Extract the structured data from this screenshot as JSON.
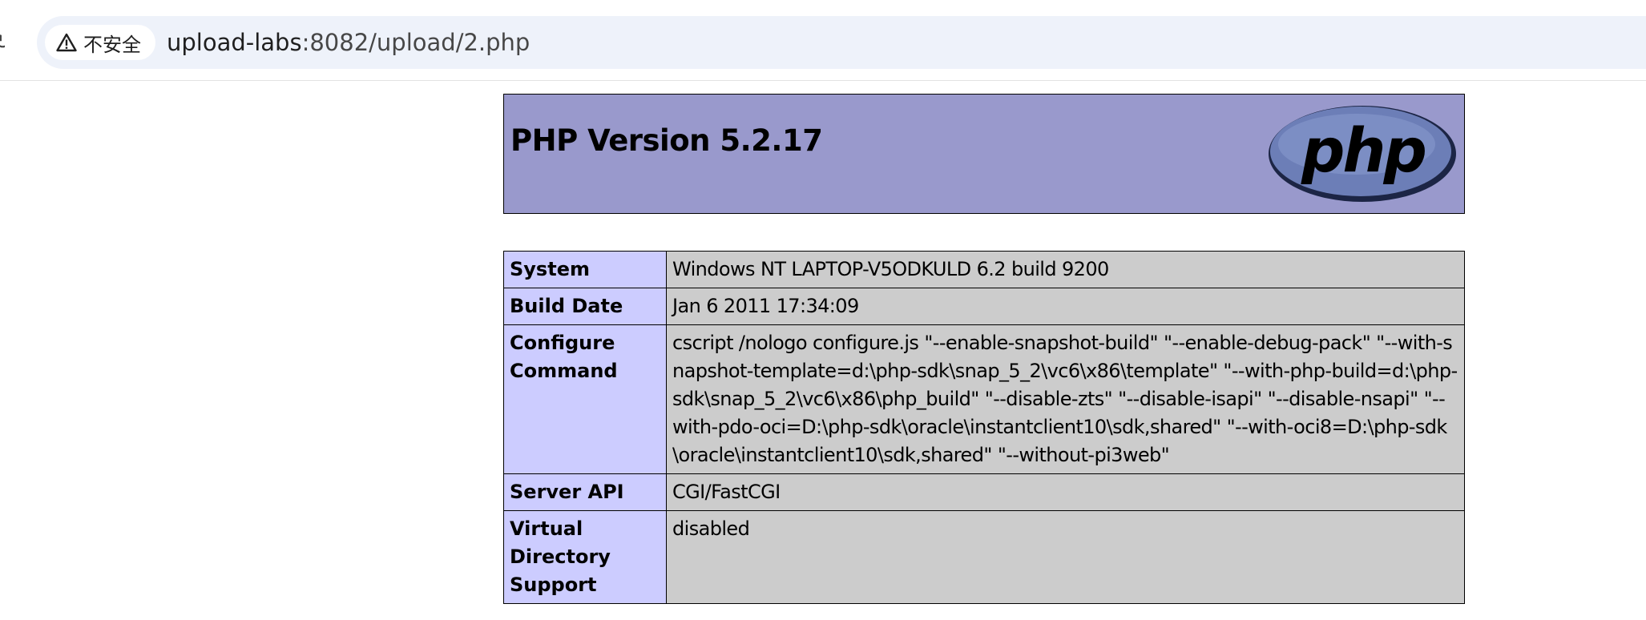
{
  "browser": {
    "security_label": "不安全",
    "url_host": "upload-labs",
    "url_rest": ":8082/upload/2.php"
  },
  "php": {
    "title": "PHP Version 5.2.17",
    "logo_text": "php",
    "rows": [
      {
        "label": "System",
        "value": "Windows NT LAPTOP-V5ODKULD 6.2 build 9200"
      },
      {
        "label": "Build Date",
        "value": "Jan 6 2011 17:34:09"
      },
      {
        "label": "Configure Command",
        "value": "cscript /nologo configure.js \"--enable-snapshot-build\" \"--enable-debug-pack\" \"--with-snapshot-template=d:\\php-sdk\\snap_5_2\\vc6\\x86\\template\" \"--with-php-build=d:\\php-sdk\\snap_5_2\\vc6\\x86\\php_build\" \"--disable-zts\" \"--disable-isapi\" \"--disable-nsapi\" \"--with-pdo-oci=D:\\php-sdk\\oracle\\instantclient10\\sdk,shared\" \"--with-oci8=D:\\php-sdk\\oracle\\instantclient10\\sdk,shared\" \"--without-pi3web\""
      },
      {
        "label": "Server API",
        "value": "CGI/FastCGI"
      },
      {
        "label": "Virtual Directory Support",
        "value": "disabled"
      }
    ]
  },
  "colors": {
    "header_bg": "#9999cc",
    "label_bg": "#ccccff",
    "value_bg": "#cccccc",
    "logo_fill": "#6c7eb7"
  }
}
